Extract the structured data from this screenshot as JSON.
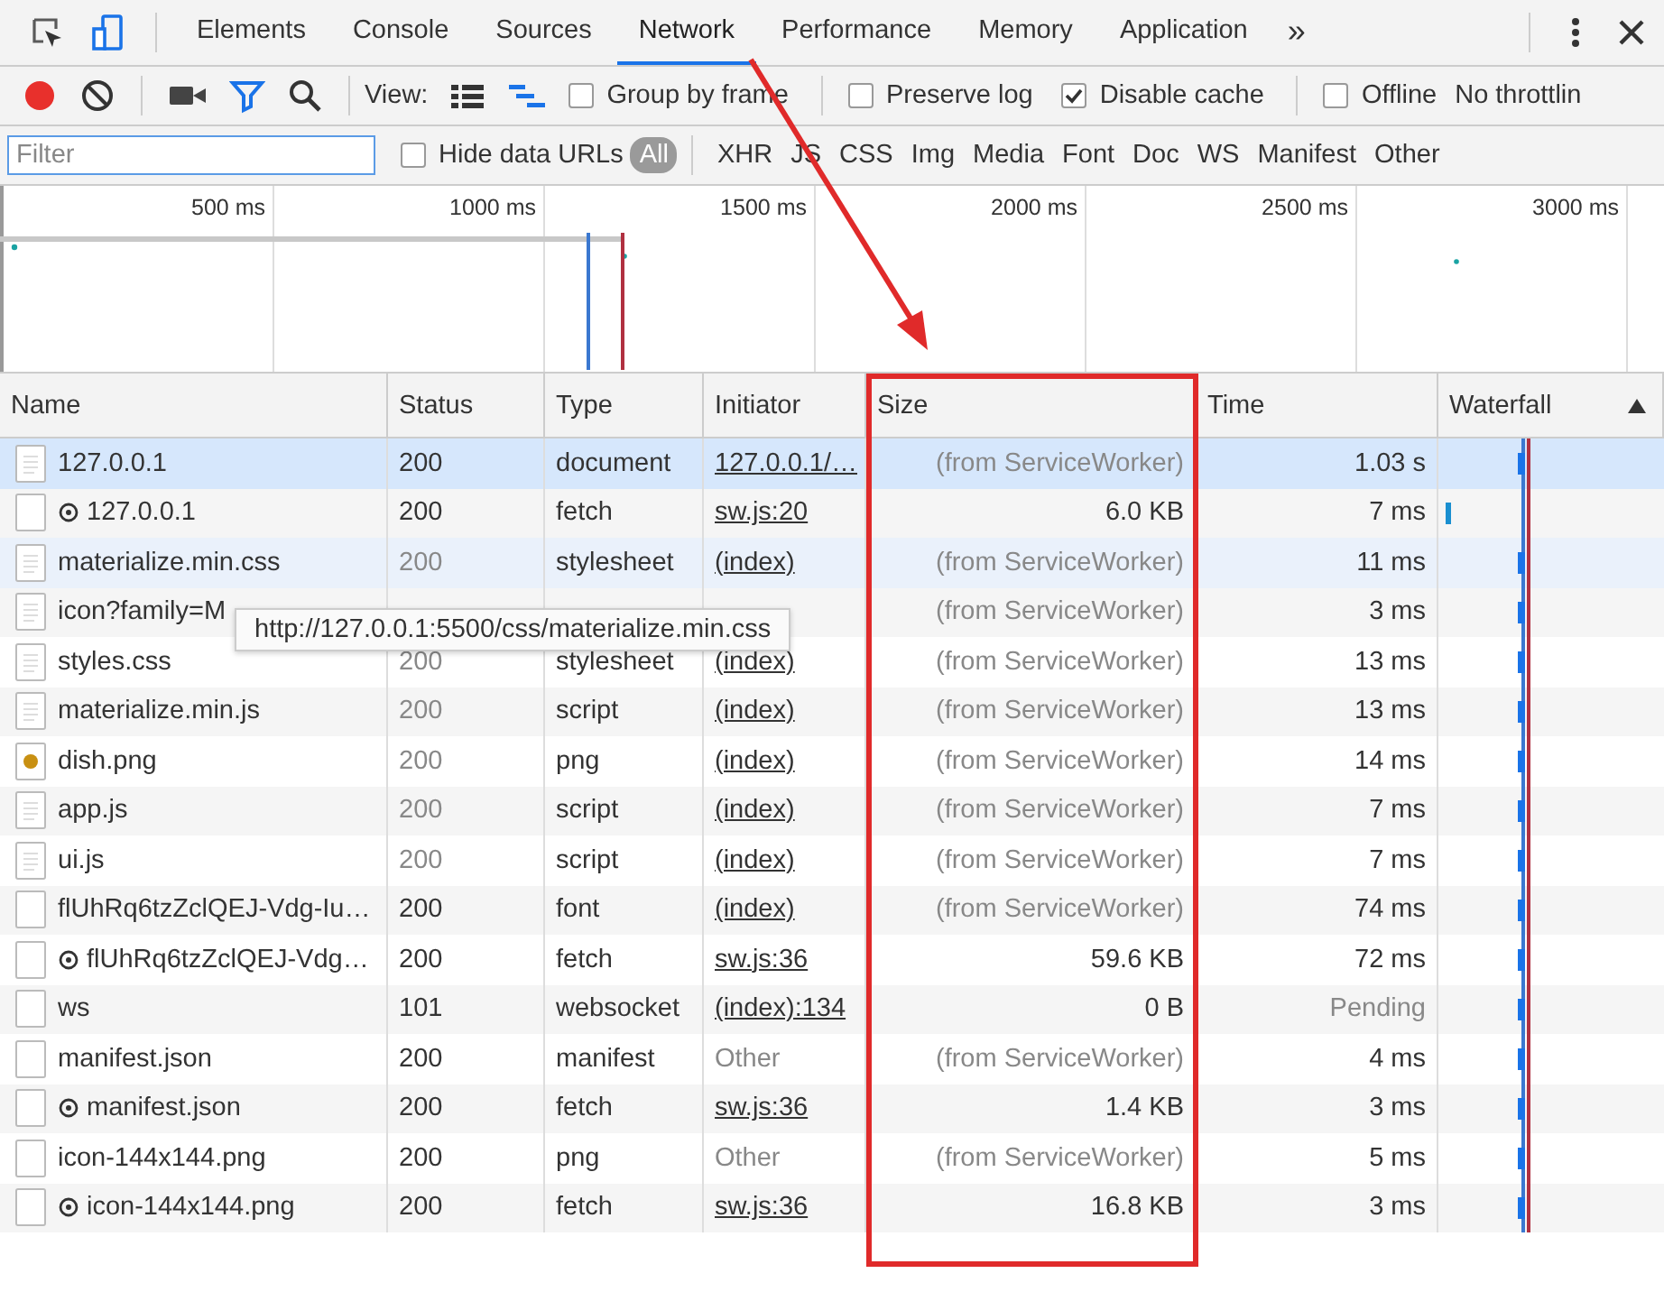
{
  "tabs": [
    {
      "label": "Elements",
      "selected": false
    },
    {
      "label": "Console",
      "selected": false
    },
    {
      "label": "Sources",
      "selected": false
    },
    {
      "label": "Network",
      "selected": true
    },
    {
      "label": "Performance",
      "selected": false
    },
    {
      "label": "Memory",
      "selected": false
    },
    {
      "label": "Application",
      "selected": false
    }
  ],
  "more_tabs": "»",
  "toolbar": {
    "recording": true,
    "filter_on": true,
    "view_label": "View:",
    "large_rows": false,
    "overview_on": true,
    "options": [
      {
        "label": "Group by frame",
        "checked": false,
        "separator_before": false
      },
      {
        "label": "Preserve log",
        "checked": false,
        "separator_before": true
      },
      {
        "label": "Disable cache",
        "checked": true,
        "separator_before": false
      },
      {
        "label": "Offline",
        "checked": false,
        "separator_before": true
      }
    ],
    "throttling": "No throttlin"
  },
  "filter_bar": {
    "placeholder": "Filter",
    "hide_data_urls": {
      "label": "Hide data URLs",
      "checked": false
    },
    "types": [
      {
        "label": "All",
        "selected": true
      },
      {
        "label": "XHR",
        "selected": false
      },
      {
        "label": "JS",
        "selected": false
      },
      {
        "label": "CSS",
        "selected": false
      },
      {
        "label": "Img",
        "selected": false
      },
      {
        "label": "Media",
        "selected": false
      },
      {
        "label": "Font",
        "selected": false
      },
      {
        "label": "Doc",
        "selected": false
      },
      {
        "label": "WS",
        "selected": false
      },
      {
        "label": "Manifest",
        "selected": false
      },
      {
        "label": "Other",
        "selected": false
      }
    ]
  },
  "timeline": {
    "ticks": [
      "500 ms",
      "1000 ms",
      "1500 ms",
      "2000 ms",
      "2500 ms",
      "3000 ms"
    ]
  },
  "table": {
    "columns": [
      {
        "label": "Name"
      },
      {
        "label": "Status"
      },
      {
        "label": "Type"
      },
      {
        "label": "Initiator"
      },
      {
        "label": "Size"
      },
      {
        "label": "Time"
      },
      {
        "label": "Waterfall",
        "sorted": true
      }
    ],
    "rows": [
      {
        "kind": "doc",
        "service_worker": false,
        "name": "127.0.0.1",
        "status": "200",
        "status_muted": false,
        "type": "document",
        "initiator": "127.0.0.1/…",
        "initiator_link": true,
        "size": "(from ServiceWorker)",
        "size_muted": true,
        "time": "1.03 s",
        "time_muted": false,
        "selected": true,
        "hovered": false
      },
      {
        "kind": "plain",
        "service_worker": true,
        "name": "127.0.0.1",
        "status": "200",
        "status_muted": false,
        "type": "fetch",
        "initiator": "sw.js:20",
        "initiator_link": true,
        "size": "6.0 KB",
        "size_muted": false,
        "time": "7 ms",
        "time_muted": false,
        "selected": false,
        "hovered": false
      },
      {
        "kind": "doc",
        "service_worker": false,
        "name": "materialize.min.css",
        "status": "200",
        "status_muted": true,
        "type": "stylesheet",
        "initiator": "(index)",
        "initiator_link": true,
        "size": "(from ServiceWorker)",
        "size_muted": true,
        "time": "11 ms",
        "time_muted": false,
        "selected": false,
        "hovered": true
      },
      {
        "kind": "doc",
        "service_worker": false,
        "name": "icon?family=M",
        "size": "(from ServiceWorker)",
        "size_muted": true,
        "time": "3 ms",
        "time_muted": false,
        "selected": false,
        "hovered": false
      },
      {
        "kind": "doc",
        "service_worker": false,
        "name": "styles.css",
        "status": "200",
        "status_muted": true,
        "type": "stylesheet",
        "initiator": "(index)",
        "initiator_link": true,
        "size": "(from ServiceWorker)",
        "size_muted": true,
        "time": "13 ms",
        "time_muted": false,
        "selected": false,
        "hovered": false
      },
      {
        "kind": "doc",
        "service_worker": false,
        "name": "materialize.min.js",
        "status": "200",
        "status_muted": true,
        "type": "script",
        "initiator": "(index)",
        "initiator_link": true,
        "size": "(from ServiceWorker)",
        "size_muted": true,
        "time": "13 ms",
        "time_muted": false,
        "selected": false,
        "hovered": false
      },
      {
        "kind": "img",
        "service_worker": false,
        "name": "dish.png",
        "status": "200",
        "status_muted": true,
        "type": "png",
        "initiator": "(index)",
        "initiator_link": true,
        "size": "(from ServiceWorker)",
        "size_muted": true,
        "time": "14 ms",
        "time_muted": false,
        "selected": false,
        "hovered": false
      },
      {
        "kind": "doc",
        "service_worker": false,
        "name": "app.js",
        "status": "200",
        "status_muted": true,
        "type": "script",
        "initiator": "(index)",
        "initiator_link": true,
        "size": "(from ServiceWorker)",
        "size_muted": true,
        "time": "7 ms",
        "time_muted": false,
        "selected": false,
        "hovered": false
      },
      {
        "kind": "doc",
        "service_worker": false,
        "name": "ui.js",
        "status": "200",
        "status_muted": true,
        "type": "script",
        "initiator": "(index)",
        "initiator_link": true,
        "size": "(from ServiceWorker)",
        "size_muted": true,
        "time": "7 ms",
        "time_muted": false,
        "selected": false,
        "hovered": false
      },
      {
        "kind": "plain",
        "service_worker": false,
        "name": "flUhRq6tzZclQEJ-Vdg-Iu…",
        "status": "200",
        "status_muted": false,
        "type": "font",
        "initiator": "(index)",
        "initiator_link": true,
        "size": "(from ServiceWorker)",
        "size_muted": true,
        "time": "74 ms",
        "time_muted": false,
        "selected": false,
        "hovered": false
      },
      {
        "kind": "plain",
        "service_worker": true,
        "name": "flUhRq6tzZclQEJ-Vdg…",
        "status": "200",
        "status_muted": false,
        "type": "fetch",
        "initiator": "sw.js:36",
        "initiator_link": true,
        "size": "59.6 KB",
        "size_muted": false,
        "time": "72 ms",
        "time_muted": false,
        "selected": false,
        "hovered": false
      },
      {
        "kind": "plain",
        "service_worker": false,
        "name": "ws",
        "status": "101",
        "status_muted": false,
        "type": "websocket",
        "initiator": "(index):134",
        "initiator_link": true,
        "size": "0 B",
        "size_muted": false,
        "time": "Pending",
        "time_muted": true,
        "selected": false,
        "hovered": false
      },
      {
        "kind": "plain",
        "service_worker": false,
        "name": "manifest.json",
        "status": "200",
        "status_muted": false,
        "type": "manifest",
        "initiator": "Other",
        "initiator_link": false,
        "size": "(from ServiceWorker)",
        "size_muted": true,
        "time": "4 ms",
        "time_muted": false,
        "selected": false,
        "hovered": false
      },
      {
        "kind": "plain",
        "service_worker": true,
        "name": "manifest.json",
        "status": "200",
        "status_muted": false,
        "type": "fetch",
        "initiator": "sw.js:36",
        "initiator_link": true,
        "size": "1.4 KB",
        "size_muted": false,
        "time": "3 ms",
        "time_muted": false,
        "selected": false,
        "hovered": false
      },
      {
        "kind": "plain",
        "service_worker": false,
        "name": "icon-144x144.png",
        "status": "200",
        "status_muted": false,
        "type": "png",
        "initiator": "Other",
        "initiator_link": false,
        "size": "(from ServiceWorker)",
        "size_muted": true,
        "time": "5 ms",
        "time_muted": false,
        "selected": false,
        "hovered": false
      },
      {
        "kind": "plain",
        "service_worker": true,
        "name": "icon-144x144.png",
        "status": "200",
        "status_muted": false,
        "type": "fetch",
        "initiator": "sw.js:36",
        "initiator_link": true,
        "size": "16.8 KB",
        "size_muted": false,
        "time": "3 ms",
        "time_muted": false,
        "selected": false,
        "hovered": false
      }
    ]
  },
  "tooltip": "http://127.0.0.1:5500/css/materialize.min.css",
  "annotations": {
    "arrow": true,
    "frame": true
  }
}
